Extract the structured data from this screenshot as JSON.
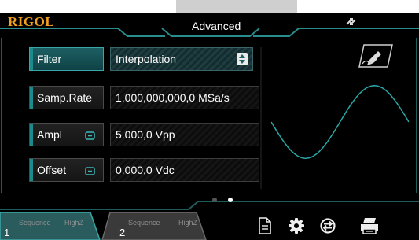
{
  "header": {
    "logo": "RIGOL",
    "mode_title": "Advanced",
    "link_icon": "link-arrows-icon"
  },
  "params": {
    "filter": {
      "label": "Filter",
      "value": "Interpolation"
    },
    "samp_rate": {
      "label": "Samp.Rate",
      "value": "1.000,000,000,0 MSa/s"
    },
    "ampl": {
      "label": "Ampl",
      "value": "5.000,0 Vpp"
    },
    "offset": {
      "label": "Offset",
      "value": "0.000,0 Vdc"
    }
  },
  "page_indicator": {
    "pages": 2,
    "current": 2
  },
  "channels": [
    {
      "number": "1",
      "mode": "Sequence",
      "load": "HighZ"
    },
    {
      "number": "2",
      "mode": "Sequence",
      "load": "HighZ"
    }
  ],
  "toolbar": {
    "icons": [
      "document-icon",
      "gear-icon",
      "sync-icon",
      "printer-icon"
    ]
  },
  "colors": {
    "logo": "#f4a21b",
    "accent_teal": "#2a8d8d",
    "waveform": "#2aa7a7",
    "background": "#000000"
  }
}
